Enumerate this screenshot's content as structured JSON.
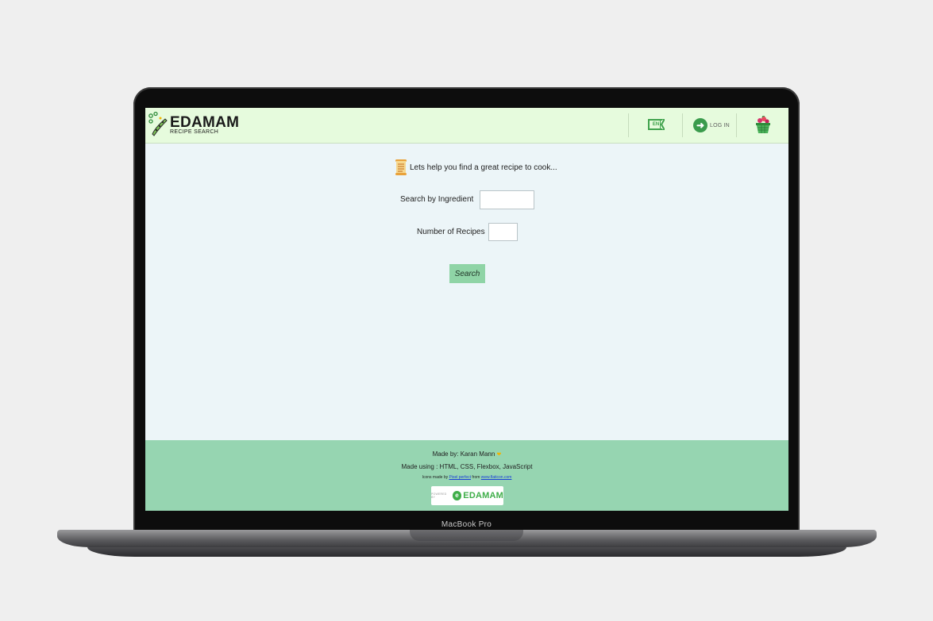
{
  "device": {
    "label": "MacBook Pro"
  },
  "header": {
    "brand": "EDAMAM",
    "brand_sub": "RECIPE SEARCH",
    "language": "EN",
    "login_label": "LOG IN",
    "accent": "#3fa24c",
    "background": "#e6fbdd"
  },
  "main": {
    "intro": "Lets help you find a great recipe to cook...",
    "ingredient_label": "Search by Ingredient",
    "ingredient_value": "",
    "recipes_label": "Number of Recipes",
    "recipes_value": "",
    "search_button": "Search",
    "background": "#ecf5f8"
  },
  "footer": {
    "made_by": "Made by: Karan Mann",
    "made_using": "Made using : HTML, CSS, Flexbox, JavaScript",
    "icons_prefix": "Icons made by",
    "icons_author": "Pixel perfect",
    "icons_middle": "from",
    "icons_site": "www.flaticon.com",
    "powered_by": "POWERED BY",
    "powered_name": "EDAMAM",
    "background": "#96d5b1"
  }
}
